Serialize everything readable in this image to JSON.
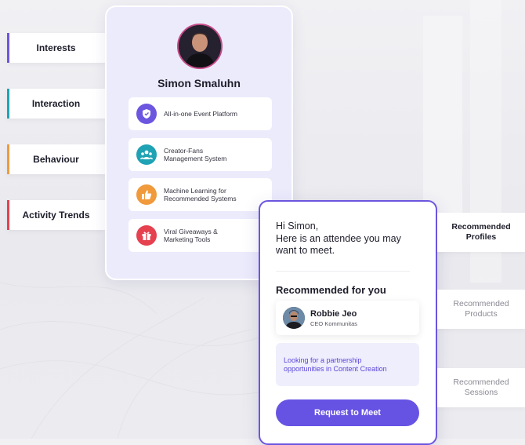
{
  "left_tags": [
    {
      "label": "Interests",
      "accent": "#6c56e0"
    },
    {
      "label": "Interaction",
      "accent": "#1fa2b4"
    },
    {
      "label": "Behaviour",
      "accent": "#f09a3c"
    },
    {
      "label": "Activity Trends",
      "accent": "#e5414f"
    }
  ],
  "profile": {
    "name": "Simon Smaluhn",
    "features": [
      {
        "icon": "shield-icon",
        "color": "#6c56e0",
        "line1": "All-in-one Event Platform",
        "line2": ""
      },
      {
        "icon": "community-icon",
        "color": "#1fa2b4",
        "line1": "Creator-Fans",
        "line2": "Management System"
      },
      {
        "icon": "thumbs-up-icon",
        "color": "#f09a3c",
        "line1": "Machine Learning for",
        "line2": "Recommended Systems"
      },
      {
        "icon": "gift-icon",
        "color": "#e5414f",
        "line1": "Viral Giveaways &",
        "line2": "Marketing Tools"
      }
    ]
  },
  "meet_card": {
    "greeting": "Hi Simon,",
    "message_line1": "Here is an attendee you may",
    "message_line2": "want to meet.",
    "section_title": "Recommended for you",
    "person_name": "Robbie Jeo",
    "person_role": "CEO Kommunitas",
    "interest_line1": "Looking for a partnership",
    "interest_line2": "opportunities in Content Creation",
    "button_label": "Request to Meet",
    "accent": "#6653e3"
  },
  "right_tags": [
    {
      "line1": "Recommended",
      "line2": "Profiles",
      "active": true
    },
    {
      "line1": "Recommended",
      "line2": "Products",
      "active": false
    },
    {
      "line1": "Recommended",
      "line2": "Sessions",
      "active": false
    }
  ]
}
